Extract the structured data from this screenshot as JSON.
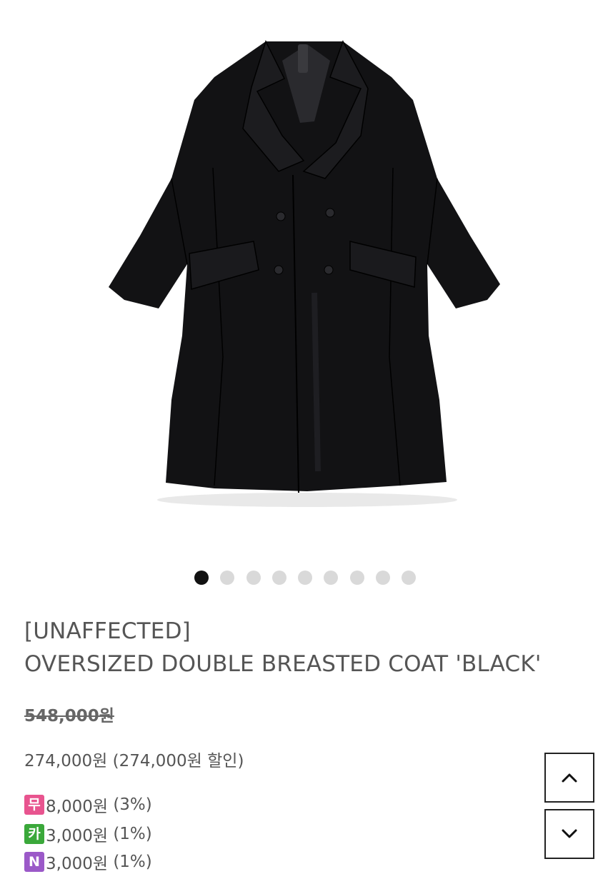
{
  "gallery": {
    "image_alt": "oversized double breasted black coat",
    "slide_count": 9,
    "active_index": 0
  },
  "product": {
    "brand": "[UNAFFECTED]",
    "name": "OVERSIZED DOUBLE BREASTED COAT 'BLACK'",
    "original_price": "548,000원",
    "sale_price": "274,000원",
    "discount_text": "(274,000원 할인)"
  },
  "benefits": [
    {
      "badge": "무",
      "badge_color": "#e8548f",
      "amount": "8,000원",
      "rate": "(3%)"
    },
    {
      "badge": "카",
      "badge_color": "#3aa83a",
      "amount": "3,000원",
      "rate": "(1%)"
    },
    {
      "badge": "N",
      "badge_color": "#9b59c8",
      "amount": "3,000원",
      "rate": "(1%)"
    }
  ],
  "controls": {
    "scroll_up": "scroll-up",
    "scroll_down": "scroll-down"
  }
}
